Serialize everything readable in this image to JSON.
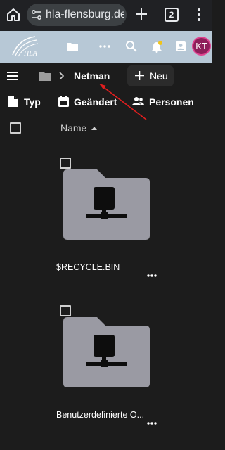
{
  "browser": {
    "url": "hla-flensburg.de",
    "tab_count": "2"
  },
  "header": {
    "avatar_initials": "KT",
    "notification_dot_color": "#f0c419"
  },
  "breadcrumb": {
    "current": "Netman",
    "new_label": "Neu"
  },
  "filters": [
    {
      "label": "Typ",
      "icon": "file-icon"
    },
    {
      "label": "Geändert",
      "icon": "calendar-icon"
    },
    {
      "label": "Personen",
      "icon": "people-icon"
    }
  ],
  "list_header": {
    "name_label": "Name",
    "sort": "ascending"
  },
  "items": [
    {
      "name": "$RECYCLE.BIN",
      "icon": "network-folder-icon"
    },
    {
      "name": "Benutzerdefinierte O...",
      "icon": "network-folder-icon"
    }
  ],
  "colors": {
    "background": "#1c1c1c",
    "header_band": "#b7c8d6",
    "folder_fill": "#9a9aa3",
    "annotation_arrow": "#e01e1e"
  }
}
